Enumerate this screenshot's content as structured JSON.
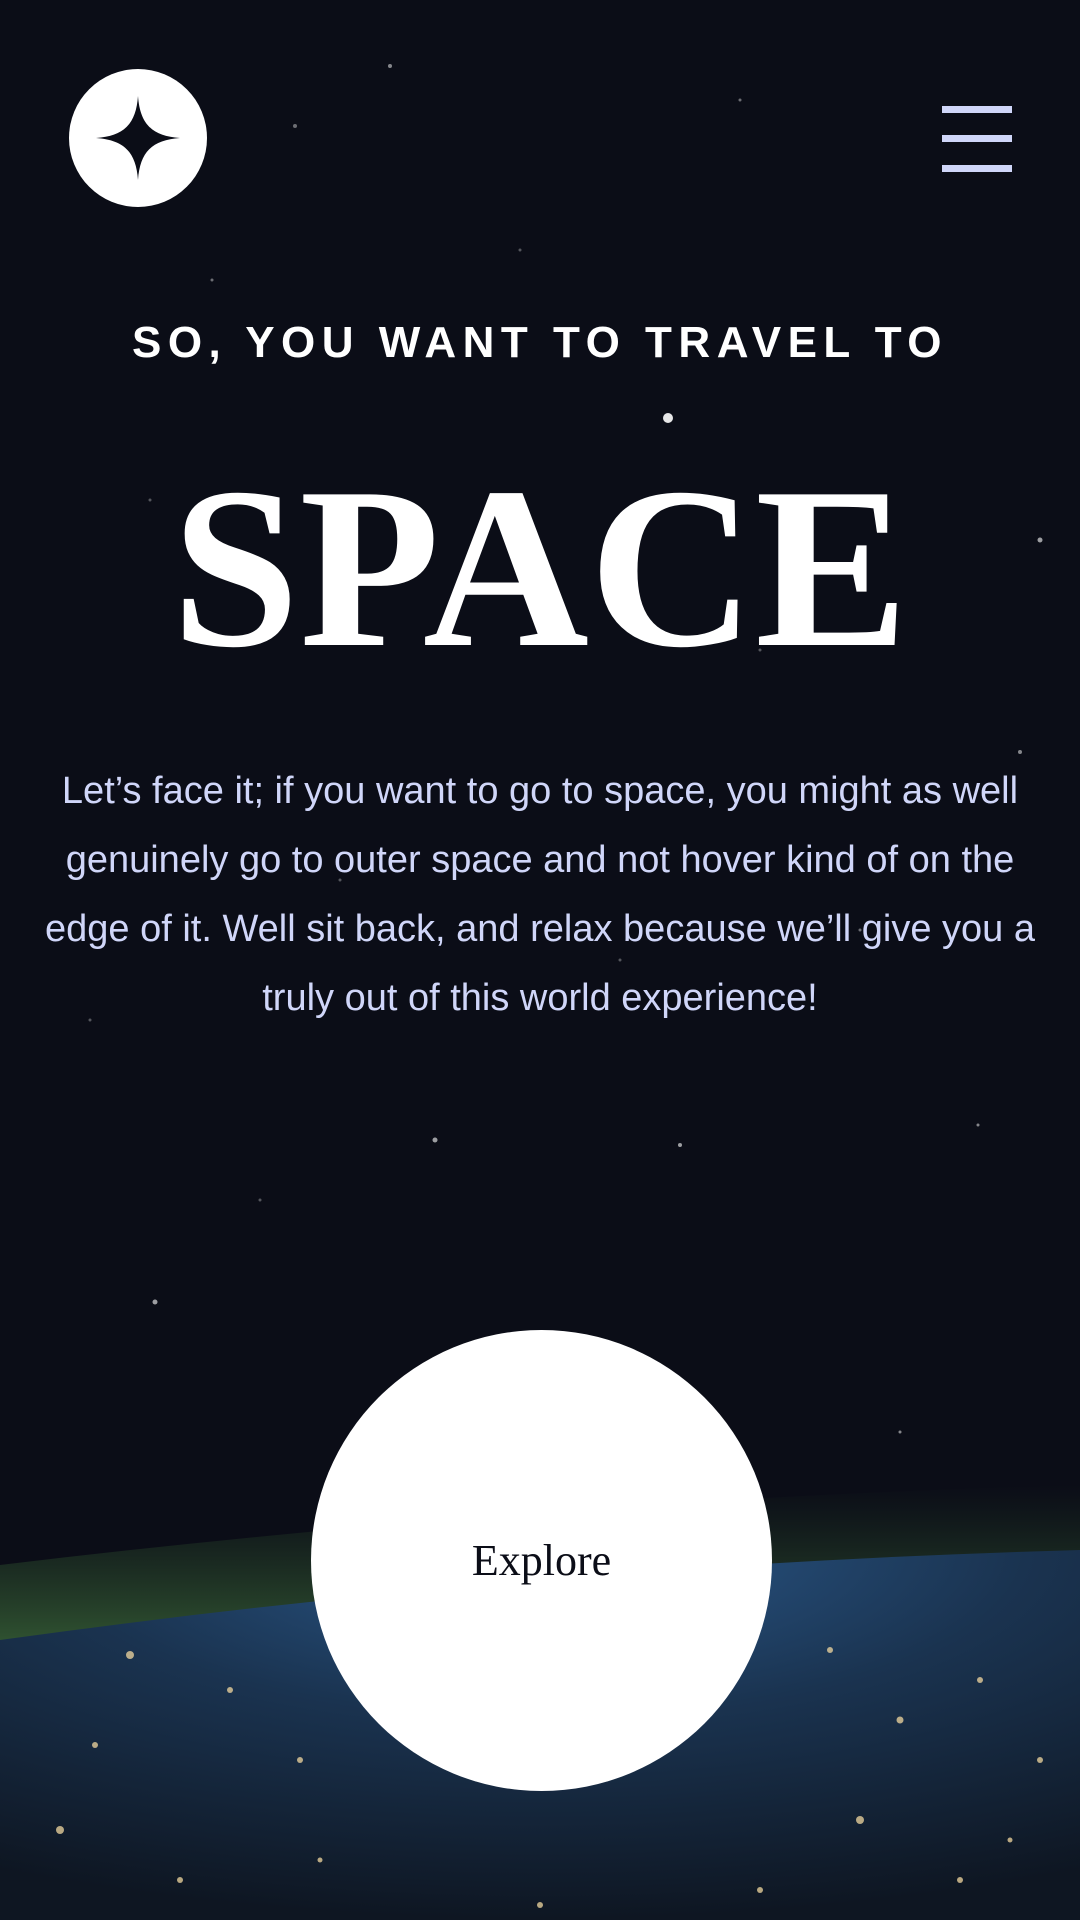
{
  "header": {
    "logo_icon": "four-point-star-icon",
    "menu_icon": "hamburger-menu-icon"
  },
  "hero": {
    "subtitle": "SO, YOU WANT TO TRAVEL TO",
    "title": "SPACE",
    "body": "Let’s face it; if you want to go to space, you might as well genuinely go to outer space and not hover kind of on the edge of it. Well sit back, and relax because we’ll give you a truly out of this world experience!",
    "cta_label": "Explore"
  },
  "colors": {
    "background": "#0b0d17",
    "accent_light": "#d0d6f9",
    "white": "#ffffff"
  }
}
